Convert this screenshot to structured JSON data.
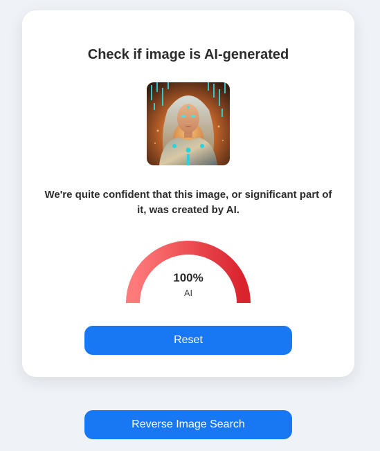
{
  "card": {
    "title": "Check if image is AI-generated",
    "message": "We're quite confident that this image, or significant part of it, was created by AI."
  },
  "result": {
    "value_label": "100%",
    "value": 1.0,
    "class_label": "AI"
  },
  "buttons": {
    "reset_label": "Reset",
    "reverse_search_label": "Reverse Image Search"
  },
  "colors": {
    "accent": "#1877f2",
    "gauge_start": "#ff7b7b",
    "gauge_end": "#d9232d",
    "background": "#eff2f6"
  },
  "icons": {
    "thumbnail": "ai-portrait-image"
  }
}
